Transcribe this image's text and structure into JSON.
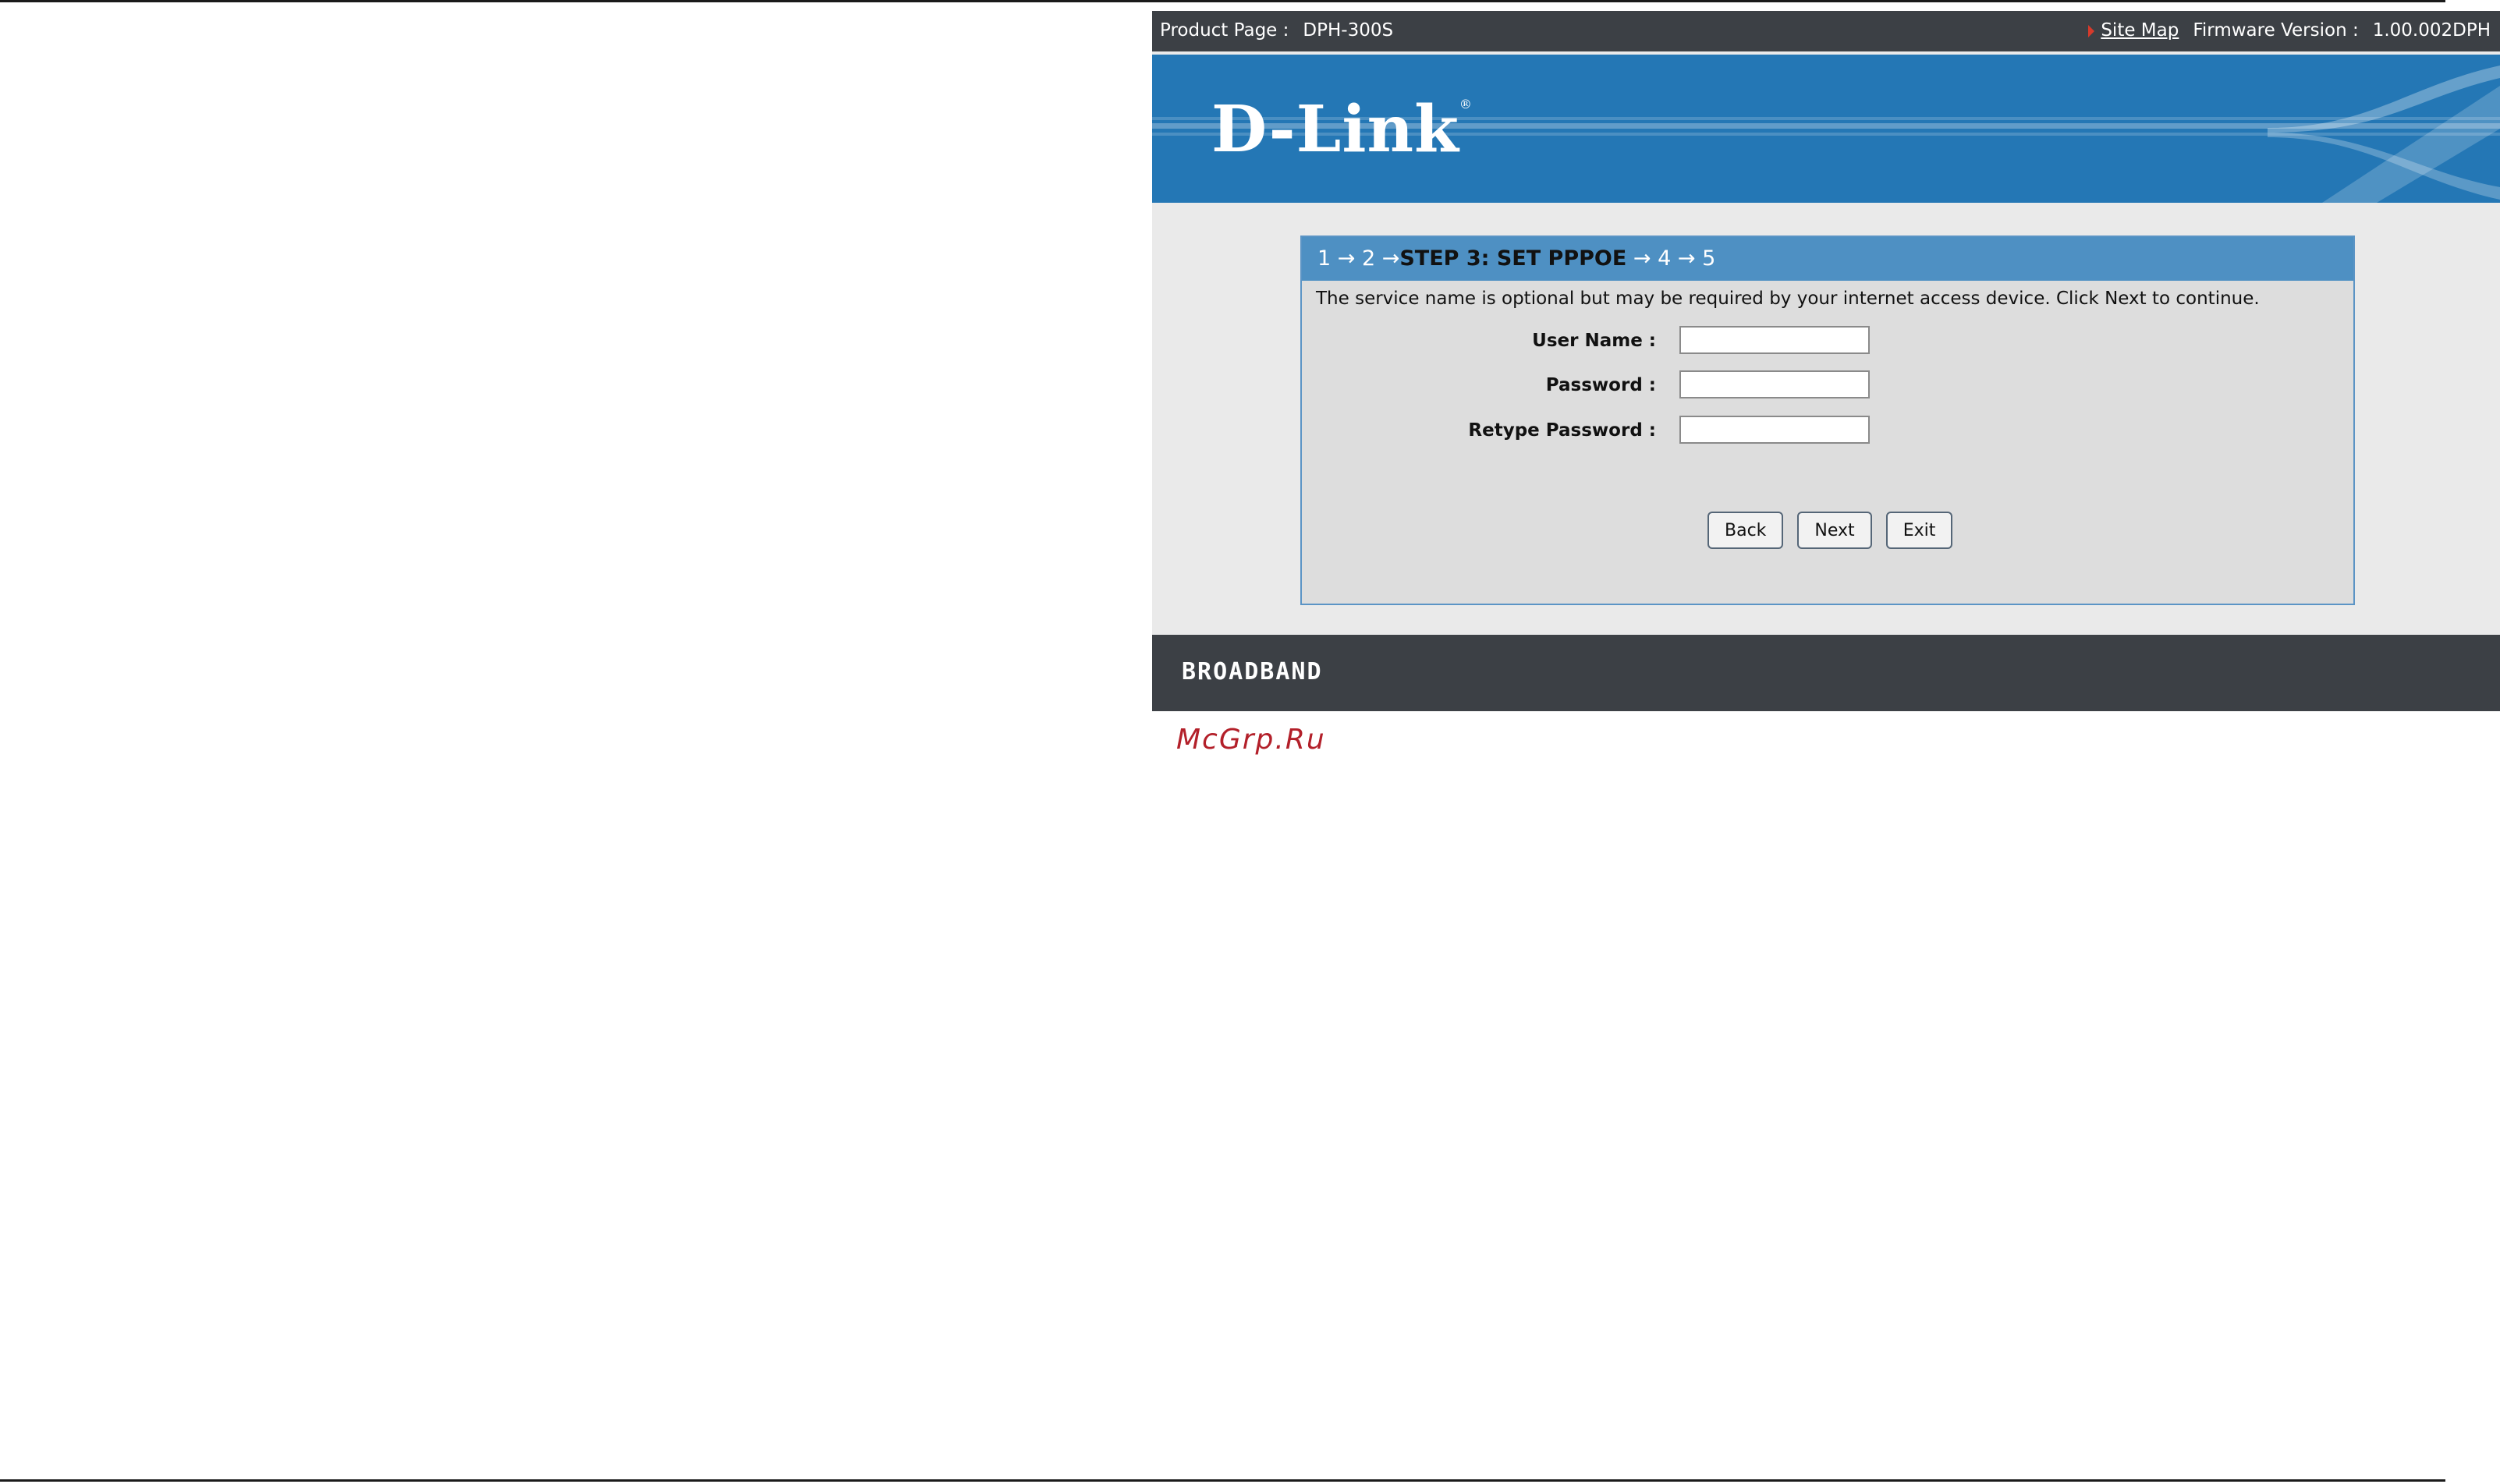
{
  "topbar": {
    "product_label": "Product Page :",
    "model": "DPH-300S",
    "site_map": "Site Map",
    "firmware_label": "Firmware Version :",
    "firmware_value": "1.00.002DPH"
  },
  "banner": {
    "logo": "D-Link",
    "logo_mark": "®"
  },
  "wizard": {
    "steps_before": "1 → 2 →",
    "current_step": "STEP 3: SET PPPOE",
    "steps_after": "→ 4 → 5",
    "description": "The service name is optional but may be required by your internet access device. Click Next to continue.",
    "fields": {
      "user_name": {
        "label": "User Name :",
        "value": ""
      },
      "password": {
        "label": "Password :",
        "value": ""
      },
      "retype_password": {
        "label": "Retype Password :",
        "value": ""
      }
    },
    "buttons": {
      "back": "Back",
      "next": "Next",
      "exit": "Exit"
    }
  },
  "footer": {
    "brand": "BROADBAND"
  },
  "watermark": "McGrp.Ru",
  "colors": {
    "banner": "#2477b5",
    "wizard_header": "#4e90c3",
    "bar": "#3c4045"
  }
}
